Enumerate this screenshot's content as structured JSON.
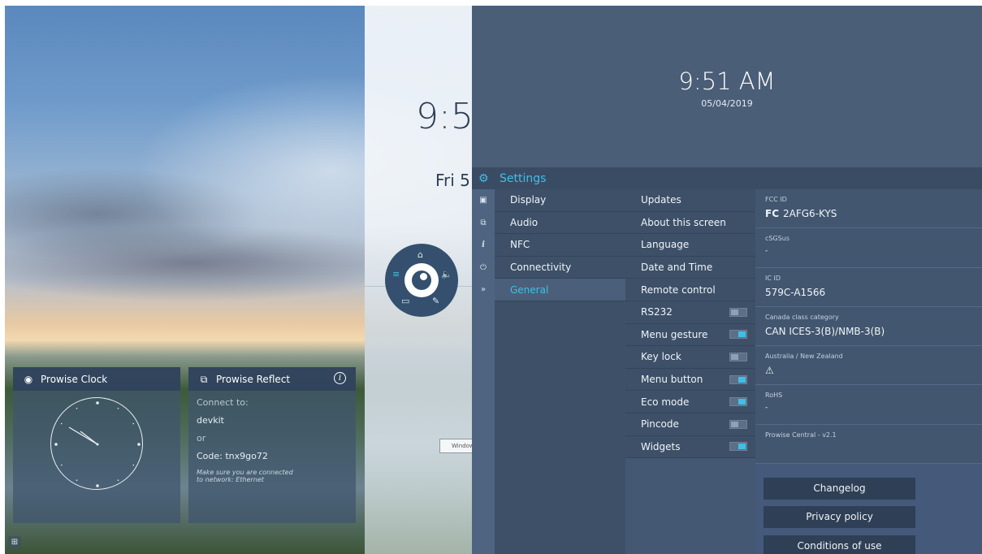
{
  "background_clock": {
    "time_partial": "9:5",
    "date_partial": "Fri 5",
    "window_button": "Windows"
  },
  "radial_menu": {
    "icons": [
      "home-icon",
      "volume-icon",
      "annotate-icon",
      "source-icon",
      "menu-icon"
    ]
  },
  "clock_widget": {
    "title": "Prowise Clock"
  },
  "reflect_widget": {
    "title": "Prowise Reflect",
    "connect_to": "Connect to:",
    "device": "devkit",
    "or": "or",
    "code": "Code: tnx9go72",
    "note_line1": "Make sure you are connected",
    "note_line2": "to network: Ethernet"
  },
  "header": {
    "time": "9:51 AM",
    "date": "05/04/2019"
  },
  "settings": {
    "title": "Settings",
    "side_icons": [
      "display-icon",
      "audio-icon",
      "info-icon",
      "power-icon",
      "expand-icon"
    ],
    "categories": [
      "Display",
      "Audio",
      "NFC",
      "Connectivity",
      "General"
    ],
    "active_category": "General",
    "general_items": [
      {
        "label": "Updates"
      },
      {
        "label": "About this screen"
      },
      {
        "label": "Language"
      },
      {
        "label": "Date and Time"
      },
      {
        "label": "Remote control"
      },
      {
        "label": "RS232",
        "toggle": "off"
      },
      {
        "label": "Menu gesture",
        "toggle": "on"
      },
      {
        "label": "Key lock",
        "toggle": "off"
      },
      {
        "label": "Menu button",
        "toggle": "on"
      },
      {
        "label": "Eco mode",
        "toggle": "on"
      },
      {
        "label": "Pincode",
        "toggle": "off"
      },
      {
        "label": "Widgets",
        "toggle": "on"
      }
    ],
    "about": [
      {
        "label": "FCC ID",
        "value": "2AFG6-KYS"
      },
      {
        "label": "cSGSus",
        "value": "-"
      },
      {
        "label": "IC ID",
        "value": "579C-A1566"
      },
      {
        "label": "Canada class category",
        "value": "CAN ICES-3(B)/NMB-3(B)"
      },
      {
        "label": "Australia / New Zealand",
        "value": "⚠"
      },
      {
        "label": "RoHS",
        "value": "-"
      },
      {
        "label": "Prowise Central - v2.1",
        "value": ""
      }
    ],
    "buttons": [
      "Changelog",
      "Privacy policy",
      "Conditions of use"
    ]
  }
}
